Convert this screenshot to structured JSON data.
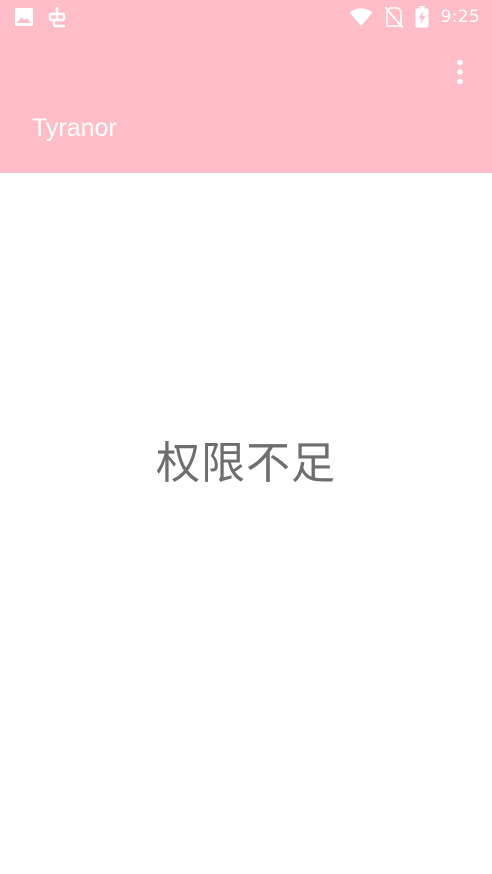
{
  "status_bar": {
    "time": "9:25",
    "left_icons": [
      "image-icon",
      "bug-icon"
    ],
    "right_icons": [
      "wifi-icon",
      "no-sim-icon",
      "battery-charging-icon"
    ]
  },
  "app_bar": {
    "title": "Tyranor",
    "overflow_icon": "more-vert-icon",
    "color": "#ffbdc8"
  },
  "content": {
    "message": "权限不足",
    "message_color": "#6e6e6e"
  }
}
